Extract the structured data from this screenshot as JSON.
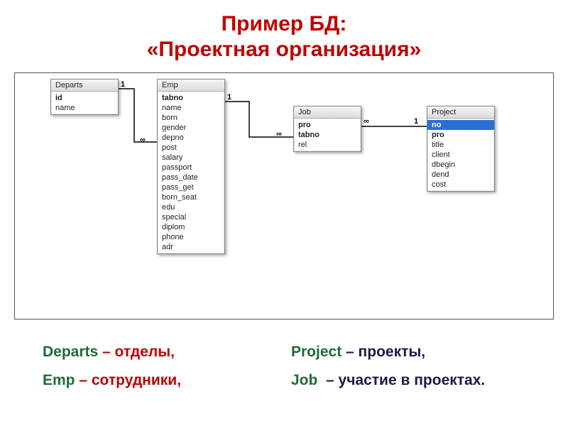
{
  "title_line1": "Пример БД:",
  "title_line2": "«Проектная организация»",
  "tables": {
    "departs": {
      "name": "Departs",
      "fields": [
        "id",
        "name"
      ]
    },
    "emp": {
      "name": "Emp",
      "fields": [
        "tabno",
        "name",
        "born",
        "gender",
        "depno",
        "post",
        "salary",
        "passport",
        "pass_date",
        "pass_get",
        "born_seat",
        "edu",
        "special",
        "diplom",
        "phone",
        "adr"
      ]
    },
    "job": {
      "name": "Job",
      "fields": [
        "pro",
        "tabno",
        "rel"
      ]
    },
    "project": {
      "name": "Project",
      "fields": [
        "no",
        "pro",
        "title",
        "client",
        "dbegin",
        "dend",
        "cost"
      ]
    }
  },
  "relations": {
    "one": "1",
    "many": "∞"
  },
  "legend": {
    "departs": {
      "term": "Departs",
      "def": " – отделы,"
    },
    "project": {
      "term": "Project",
      "def": " – проекты,"
    },
    "emp": {
      "term": "Emp",
      "def": " – сотрудники,"
    },
    "job": {
      "term": "Job",
      "def": "– участие в проектах."
    }
  }
}
